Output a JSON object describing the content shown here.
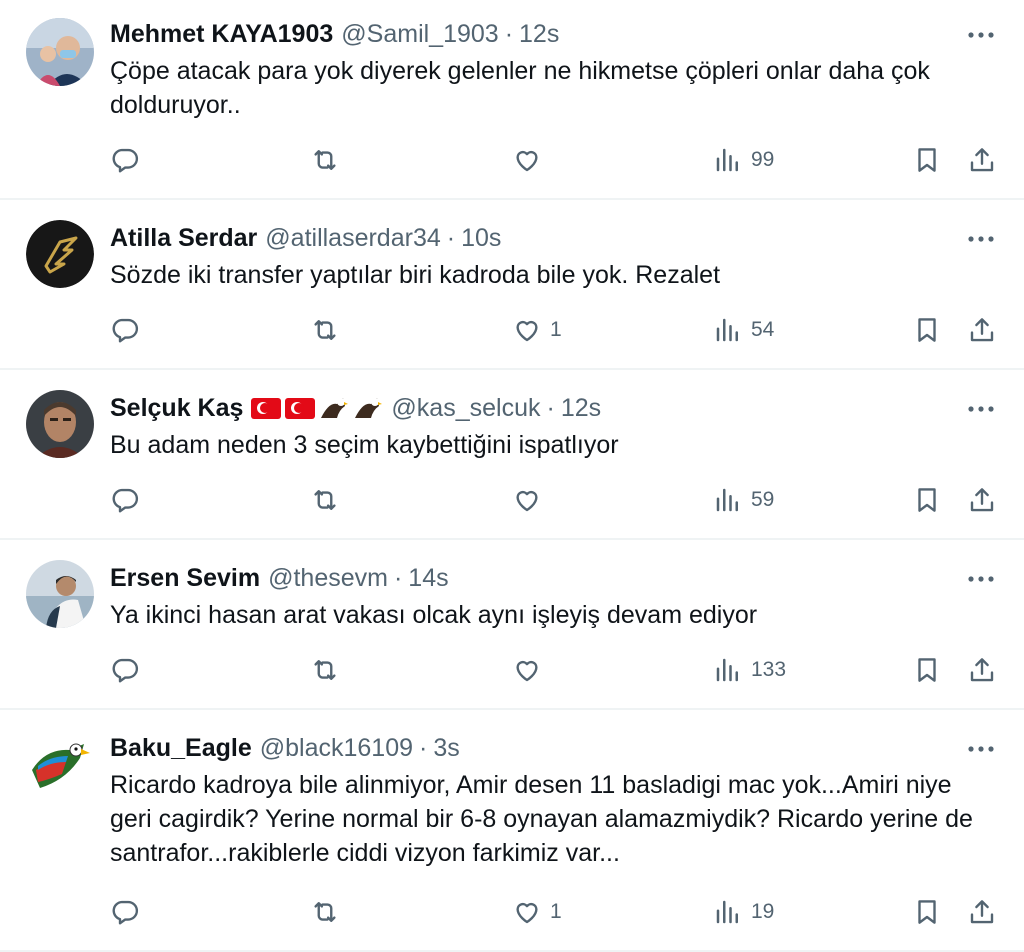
{
  "tweets": [
    {
      "name": "Mehmet KAYA1903",
      "handle": "@Samil_1903",
      "separator": "·",
      "time": "12s",
      "text": "Çöpe atacak para yok diyerek gelenler ne hikmetse çöpleri onlar daha çok dolduruyor..",
      "likes": "",
      "views": "99",
      "avatar_icon": "avatar-photo-man-with-child"
    },
    {
      "name": "Atilla Serdar",
      "handle": "@atillaserdar34",
      "separator": "·",
      "time": "10s",
      "text": "Sözde iki transfer yaptılar biri kadroda bile yok. Rezalet",
      "likes": "1",
      "views": "54",
      "avatar_icon": "golden-wing-logo"
    },
    {
      "name": "Selçuk Kaş",
      "handle": "@kas_selcuk",
      "separator": "·",
      "time": "12s",
      "text": "Bu adam neden 3 seçim kaybettiğini ispatlıyor",
      "likes": "",
      "views": "59",
      "avatar_icon": "portrait-man",
      "name_emojis": [
        "turkey-flag",
        "turkey-flag",
        "eagle",
        "eagle"
      ]
    },
    {
      "name": "Ersen Sevim",
      "handle": "@thesevm",
      "separator": "·",
      "time": "14s",
      "text": "Ya ikinci hasan arat vakası olcak aynı işleyiş devam ediyor",
      "likes": "",
      "views": "133",
      "avatar_icon": "photo-man-by-sea"
    },
    {
      "name": "Baku_Eagle",
      "handle": "@black16109",
      "separator": "·",
      "time": "3s",
      "text": "Ricardo kadroya bile alinmiyor, Amir desen 11 basladigi mac yok...Amiri niye geri cagirdik? Yerine normal bir 6-8 oynayan alamazmiydik? Ricardo yerine de santrafor...rakiblerle ciddi vizyon farkimiz var...",
      "likes": "1",
      "views": "19",
      "avatar_icon": "azerbaijan-eagle"
    }
  ],
  "colors": {
    "text": "#0f1419",
    "secondary": "#536471",
    "divider": "#eff3f4",
    "flag_red": "#e30a17"
  }
}
